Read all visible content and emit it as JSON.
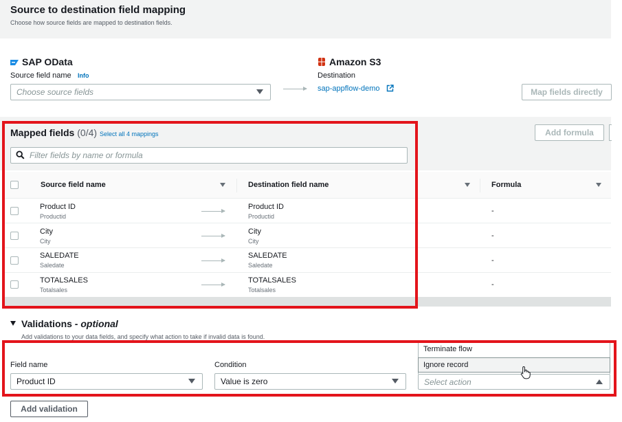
{
  "header": {
    "title": "Source to destination field mapping",
    "description": "Choose how source fields are mapped to destination fields."
  },
  "source": {
    "name": "SAP OData",
    "field_label": "Source field name",
    "info_link": "Info",
    "select_placeholder": "Choose source fields"
  },
  "destination": {
    "name": "Amazon S3",
    "label": "Destination",
    "link": "sap-appflow-demo"
  },
  "map_directly_button": "Map fields directly",
  "mapped": {
    "title": "Mapped fields",
    "count": "(0/4)",
    "select_all_link": "Select all 4 mappings",
    "add_formula_button": "Add formula",
    "filter_placeholder": "Filter fields by name or formula",
    "columns": {
      "source": "Source field name",
      "destination": "Destination field name",
      "formula": "Formula"
    },
    "rows": [
      {
        "src": "Product ID",
        "src_sub": "Productid",
        "dst": "Product ID",
        "dst_sub": "Productid",
        "formula": "-"
      },
      {
        "src": "City",
        "src_sub": "City",
        "dst": "City",
        "dst_sub": "City",
        "formula": "-"
      },
      {
        "src": "SALEDATE",
        "src_sub": "Saledate",
        "dst": "SALEDATE",
        "dst_sub": "Saledate",
        "formula": "-"
      },
      {
        "src": "TOTALSALES",
        "src_sub": "Totalsales",
        "dst": "TOTALSALES",
        "dst_sub": "Totalsales",
        "formula": "-"
      }
    ]
  },
  "validations": {
    "title": "Validations - ",
    "optional": "optional",
    "description": "Add validations to your data fields, and specify what action to take if invalid data is found.",
    "field_name_label": "Field name",
    "condition_label": "Condition",
    "field_name_value": "Product ID",
    "condition_value": "Value is zero",
    "action_placeholder": "Select action",
    "action_options": [
      "Terminate flow",
      "Ignore record"
    ],
    "add_button": "Add validation"
  },
  "colors": {
    "accent": "#0073bb",
    "highlight": "#e3141b",
    "sap": "#1a8ce4",
    "s3": "#d13212"
  }
}
